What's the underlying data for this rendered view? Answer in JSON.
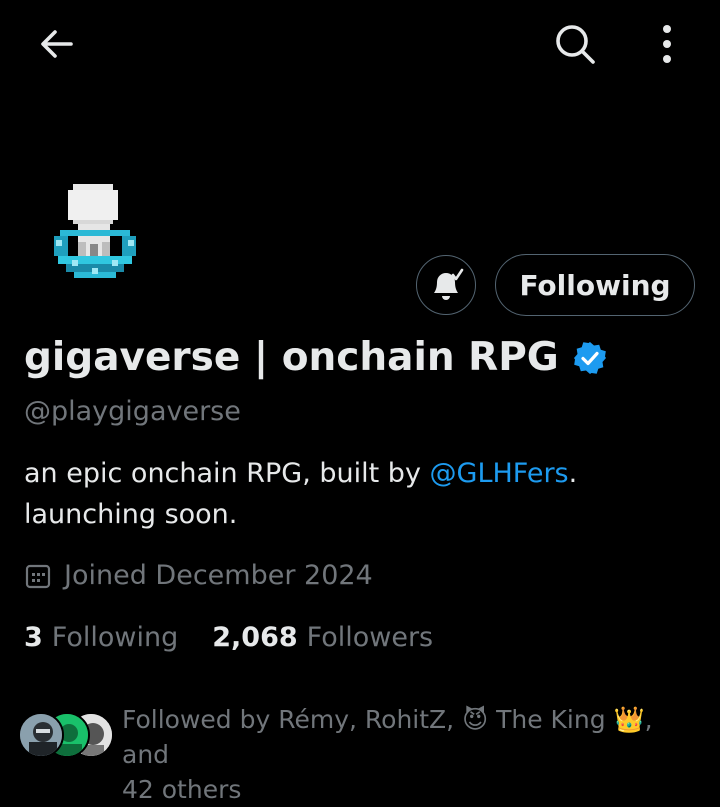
{
  "header": {
    "back_icon": "arrow-left-icon",
    "search_icon": "search-icon",
    "more_icon": "more-vertical-icon"
  },
  "profile": {
    "avatar_icon": "pixel-ghost-avatar",
    "notify_icon": "bell-check-icon",
    "follow_button_label": "Following",
    "display_name": "gigaverse | onchain RPG",
    "verified_icon": "verified-badge-icon",
    "handle": "@playgigaverse",
    "bio": {
      "text_before": "an epic onchain RPG, built by ",
      "mention": "@GLHFers",
      "text_after": ".",
      "line2": "launching soon."
    },
    "joined_icon": "calendar-icon",
    "joined": "Joined December 2024",
    "stats": {
      "following_count": "3",
      "following_label": "Following",
      "followers_count": "2,068",
      "followers_label": "Followers"
    },
    "followed_by": {
      "prefix": "Followed by Rémy, RohitZ, ",
      "emoji1": "😈",
      "name3": " The King ",
      "emoji2": "👑",
      "suffix": ", and",
      "line2": "42 others"
    }
  },
  "colors": {
    "background": "#000000",
    "text": "#e7e9ea",
    "secondary": "#71767b",
    "accent": "#1d9bf0",
    "border": "#536471"
  }
}
